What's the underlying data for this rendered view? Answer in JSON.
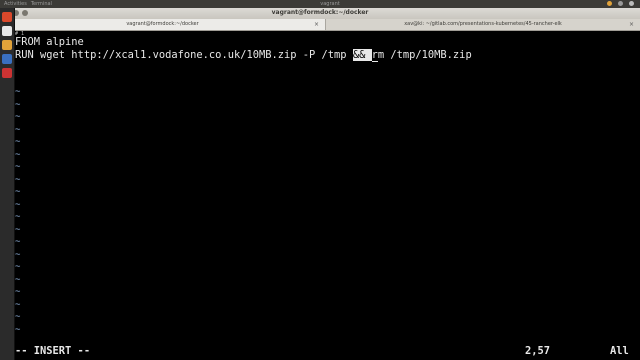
{
  "topbar": {
    "apps": [
      "Activities",
      "Terminal"
    ],
    "window_title": "vagrant"
  },
  "window": {
    "title": "vagrant@formdock:~/docker",
    "tabs": [
      {
        "label": "vagrant@formdock:~/docker"
      },
      {
        "label": "xav@ki: ~/gitlab.com/presentations-kubernetes/45-rancher-elk"
      }
    ]
  },
  "terminal": {
    "prompt_fragment": "# 1",
    "lines": {
      "l1": "FROM alpine",
      "l2_before": "RUN wget http://xcal1.vodafone.co.uk/10MB.zip -P /tmp ",
      "l2_highlight": "&& ",
      "l2_cursor": "r",
      "l2_after": "m /tmp/10MB.zip"
    },
    "tilde": "~",
    "status_mode": "-- INSERT --",
    "cursor_position": "2,57",
    "scroll_state": "All"
  },
  "colors": {
    "background": "#000000",
    "text": "#e8e8e8",
    "tilde": "#8fb0d8",
    "accent_close": "#e9552b"
  }
}
